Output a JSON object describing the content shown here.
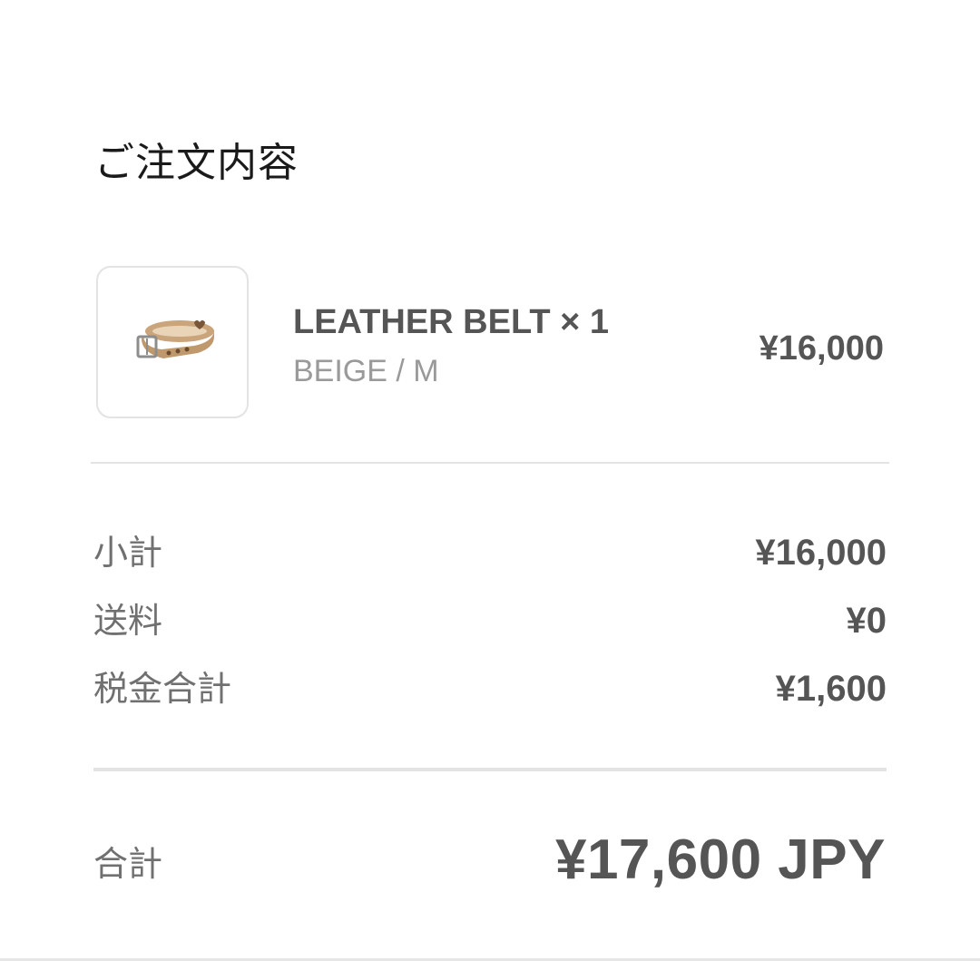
{
  "order": {
    "title": "ご注文内容",
    "item": {
      "name": "LEATHER BELT × 1",
      "variant": "BEIGE / M",
      "price": "¥16,000",
      "image_icon": "leather-belt-image"
    },
    "summary": [
      {
        "label": "小計",
        "value": "¥16,000"
      },
      {
        "label": "送料",
        "value": "¥0"
      },
      {
        "label": "税金合計",
        "value": "¥1,600"
      }
    ],
    "total": {
      "label": "合計",
      "value": "¥17,600 JPY"
    }
  },
  "colors": {
    "text_primary": "#1a1a1a",
    "text_body": "#555555",
    "text_muted": "#9a9a9a",
    "divider": "#e3e3e3",
    "belt_leather": "#c9a57a"
  }
}
